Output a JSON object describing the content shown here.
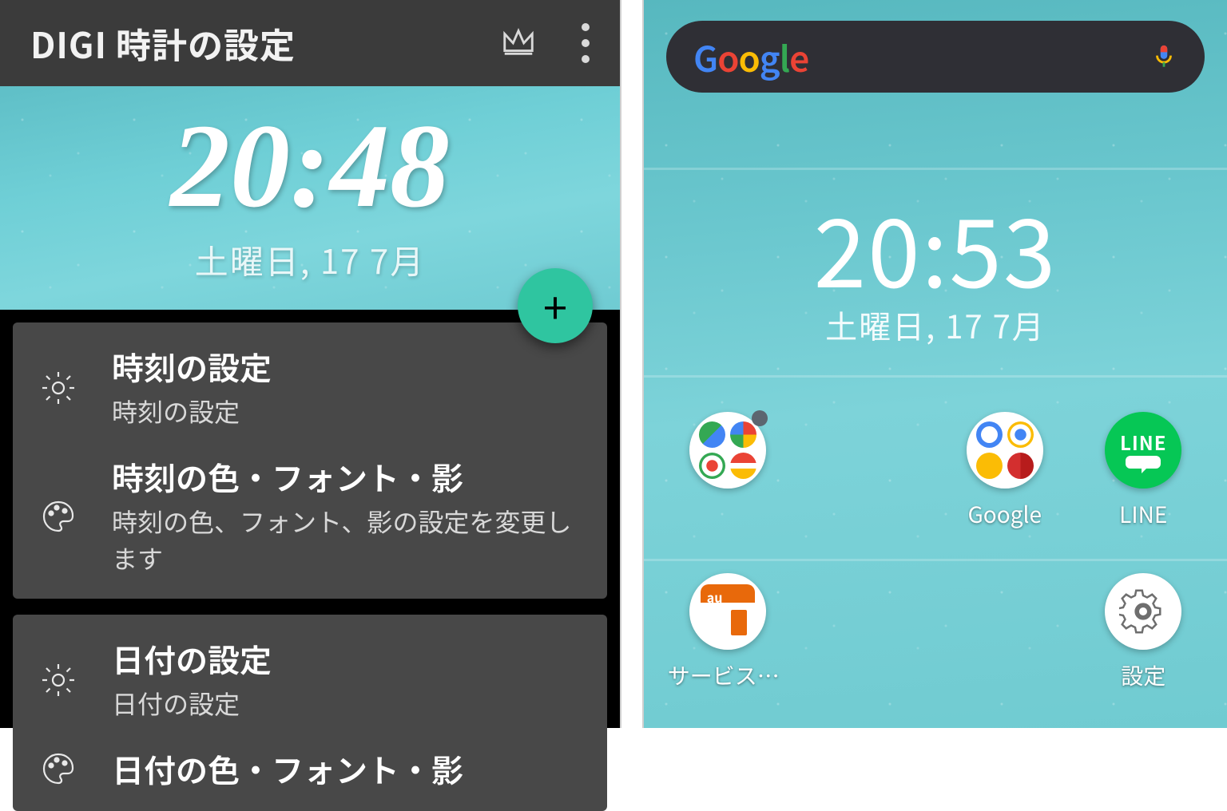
{
  "left": {
    "title": "DIGI 時計の設定",
    "preview": {
      "time": "20:48",
      "date": "土曜日,  17  7月"
    },
    "fab_label": "+",
    "rows": [
      {
        "icon": "gear",
        "title": "時刻の設定",
        "sub": "時刻の設定"
      },
      {
        "icon": "palette",
        "title": "時刻の色・フォント・影",
        "sub": "時刻の色、フォント、影の設定を変更します"
      },
      {
        "icon": "gear",
        "title": "日付の設定",
        "sub": "日付の設定"
      },
      {
        "icon": "palette",
        "title": "日付の色・フォント・影",
        "sub": ""
      }
    ]
  },
  "right": {
    "search_brand": "Google",
    "clock": {
      "time": "20:53",
      "date": "土曜日,  17  7月"
    },
    "apps": [
      {
        "slot": 0,
        "type": "folder-google-1",
        "label": ""
      },
      {
        "slot": 2,
        "type": "folder-google-2",
        "label": "Google"
      },
      {
        "slot": 3,
        "type": "line",
        "label": "LINE"
      },
      {
        "slot": 4,
        "type": "au-service",
        "label": "サービスTo…"
      },
      {
        "slot": 7,
        "type": "settings",
        "label": "設定"
      }
    ]
  }
}
